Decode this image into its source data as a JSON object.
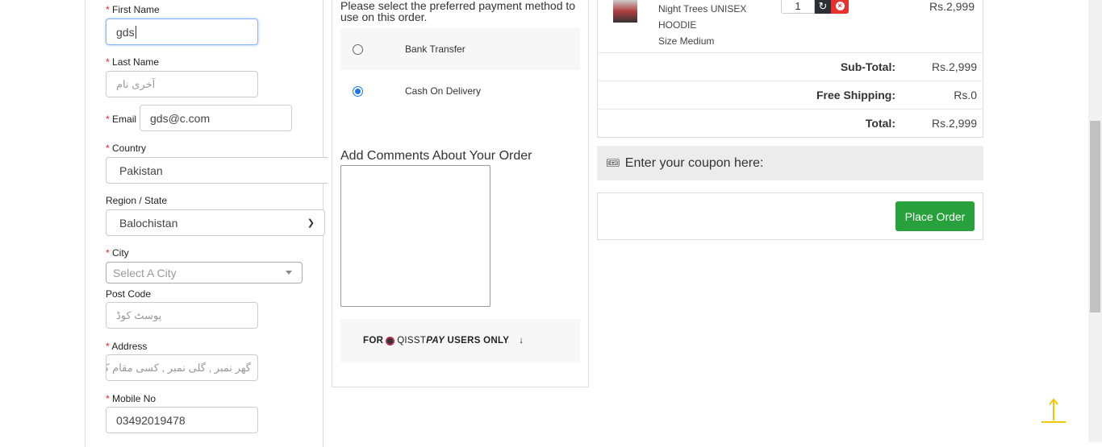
{
  "form": {
    "first_name": {
      "label": "First Name",
      "value": "gds"
    },
    "last_name": {
      "label": "Last Name",
      "placeholder": "آخری نام"
    },
    "email": {
      "label": "Email",
      "value": "gds@c.com"
    },
    "country": {
      "label": "Country",
      "value": "Pakistan"
    },
    "region": {
      "label": "Region / State",
      "value": "Balochistan"
    },
    "city": {
      "label": "City",
      "placeholder": "Select A City"
    },
    "post_code": {
      "label": "Post Code",
      "placeholder": "پوسٹ کوڈ"
    },
    "address": {
      "label": "Address",
      "placeholder": "گھر نمبر , گلی نمبر , کسی مقام کی نشانی"
    },
    "mobile": {
      "label": "Mobile No",
      "value": "03492019478"
    },
    "required_mark": "*"
  },
  "payment": {
    "instructions": "Please select the preferred payment method to use on this order.",
    "methods": [
      {
        "label": "Bank Transfer",
        "selected": false
      },
      {
        "label": "Cash On Delivery",
        "selected": true
      }
    ],
    "comments_label": "Add Comments About Your Order",
    "qisstpay": {
      "for": "FOR",
      "brand1": "QISST",
      "brand2": "PAY",
      "rest": "USERS ONLY",
      "arrow": "↓"
    }
  },
  "cart": {
    "item": {
      "name1": "Night Trees UNISEX",
      "name2": "HOODIE",
      "option": "Size Medium",
      "qty": "1",
      "price": "Rs.2,999"
    },
    "totals": [
      {
        "label": "Sub-Total:",
        "value": "Rs.2,999"
      },
      {
        "label": "Free Shipping:",
        "value": "Rs.0"
      },
      {
        "label": "Total:",
        "value": "Rs.2,999"
      }
    ],
    "coupon_label": "Enter your coupon here:",
    "place_order": "Place Order"
  },
  "colors": {
    "green": "#28a03c",
    "red": "#e8312f",
    "accent": "#1a73e8",
    "yellow": "#f2c800"
  }
}
